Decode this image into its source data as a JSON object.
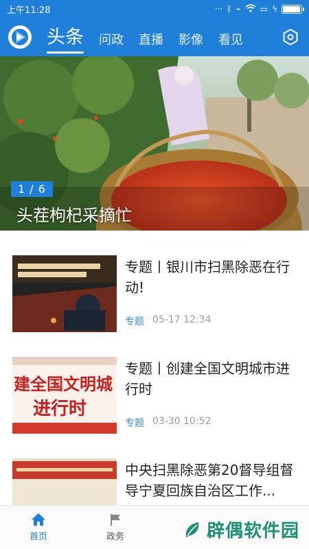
{
  "status_bar": {
    "time": "上午11:28",
    "icons": [
      "signal-icon",
      "bluetooth-icon",
      "mute-icon",
      "wifi-icon",
      "sim-icon",
      "charging-icon",
      "battery-icon"
    ],
    "battery_level": 1.0
  },
  "nav": {
    "logo_icon": "app-logo-icon",
    "tabs": [
      {
        "label": "头条",
        "active": true
      },
      {
        "label": "问政"
      },
      {
        "label": "直播"
      },
      {
        "label": "影像"
      },
      {
        "label": "看见"
      }
    ],
    "settings_icon": "settings-hexagon-icon"
  },
  "hero": {
    "counter": "1 / 6",
    "caption": "头茬枸杞采摘忙"
  },
  "news": [
    {
      "title": "专题丨银川市扫黑除恶在行动!",
      "tag": "专题",
      "time": "05-17 12:34"
    },
    {
      "title": "专题丨创建全国文明城市进行时",
      "tag": "专题",
      "time": "03-30 10:52",
      "thumb_text": [
        "建全国文明城",
        "进行时"
      ]
    },
    {
      "title": "中央扫黑除恶第20督导组督导宁夏回族自治区工作...",
      "tag": "",
      "time": ""
    }
  ],
  "bottom_nav": [
    {
      "label": "首页",
      "icon": "home-icon",
      "active": true
    },
    {
      "label": "政务",
      "icon": "flag-icon"
    }
  ],
  "watermark": "辟偶软件园",
  "colors": {
    "brand": "#1f7fd9",
    "tag": "#3d8fd8",
    "watermark": "#1e8f75"
  }
}
